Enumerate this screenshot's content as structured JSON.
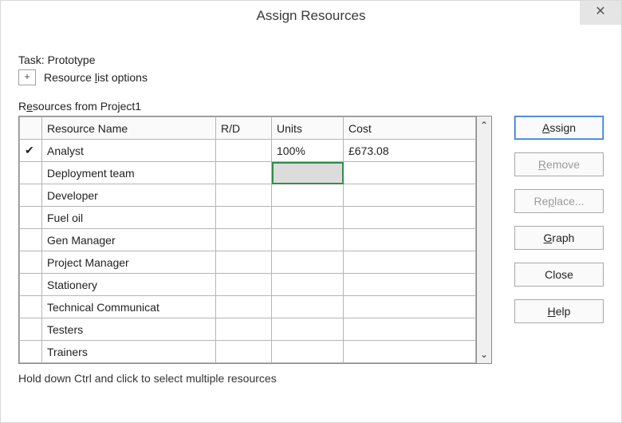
{
  "dialog": {
    "title": "Assign Resources",
    "close_glyph": "✕"
  },
  "task": {
    "prefix": "Task: ",
    "name": "Prototype"
  },
  "resource_list_options": {
    "expand_glyph": "+",
    "label_pre": "Resource ",
    "label_mn": "l",
    "label_post": "ist options"
  },
  "resources_from": {
    "label_pre": "R",
    "label_mn": "e",
    "label_post": "sources from ",
    "project": "Project1"
  },
  "columns": {
    "check": "",
    "resource_name": "Resource Name",
    "rd": "R/D",
    "units": "Units",
    "cost": "Cost"
  },
  "rows": [
    {
      "checked": true,
      "name": "Analyst",
      "rd": "",
      "units": "100%",
      "cost": "£673.08",
      "units_selected": false
    },
    {
      "checked": false,
      "name": "Deployment team",
      "rd": "",
      "units": "",
      "cost": "",
      "units_selected": true
    },
    {
      "checked": false,
      "name": "Developer",
      "rd": "",
      "units": "",
      "cost": "",
      "units_selected": false
    },
    {
      "checked": false,
      "name": "Fuel oil",
      "rd": "",
      "units": "",
      "cost": "",
      "units_selected": false
    },
    {
      "checked": false,
      "name": "Gen Manager",
      "rd": "",
      "units": "",
      "cost": "",
      "units_selected": false
    },
    {
      "checked": false,
      "name": "Project Manager",
      "rd": "",
      "units": "",
      "cost": "",
      "units_selected": false
    },
    {
      "checked": false,
      "name": "Stationery",
      "rd": "",
      "units": "",
      "cost": "",
      "units_selected": false
    },
    {
      "checked": false,
      "name": "Technical Communicat",
      "rd": "",
      "units": "",
      "cost": "",
      "units_selected": false
    },
    {
      "checked": false,
      "name": "Testers",
      "rd": "",
      "units": "",
      "cost": "",
      "units_selected": false
    },
    {
      "checked": false,
      "name": "Trainers",
      "rd": "",
      "units": "",
      "cost": "",
      "units_selected": false
    }
  ],
  "scroll": {
    "up_glyph": "⌃",
    "down_glyph": "⌄"
  },
  "buttons": {
    "assign": {
      "mn": "A",
      "rest": "ssign",
      "enabled": true,
      "primary": true
    },
    "remove": {
      "mn": "R",
      "rest": "emove",
      "enabled": false,
      "primary": false
    },
    "replace": {
      "pre": "Re",
      "mn": "p",
      "post": "lace...",
      "enabled": false,
      "primary": false
    },
    "graph": {
      "mn": "G",
      "rest": "raph",
      "enabled": true,
      "primary": false
    },
    "close": {
      "label": "Close",
      "enabled": true,
      "primary": false
    },
    "help": {
      "mn": "H",
      "rest": "elp",
      "enabled": true,
      "primary": false
    }
  },
  "hint": "Hold down Ctrl and click to select multiple resources"
}
